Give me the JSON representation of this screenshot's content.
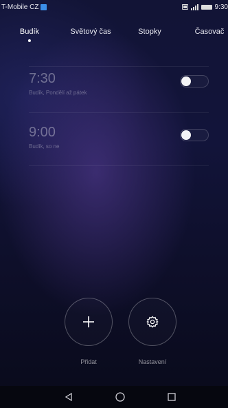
{
  "status_bar": {
    "carrier": "T-Mobile CZ",
    "time": "9:30"
  },
  "tabs": [
    {
      "label": "Budík",
      "active": true
    },
    {
      "label": "Světový čas",
      "active": false
    },
    {
      "label": "Stopky",
      "active": false
    },
    {
      "label": "Časovač",
      "active": false
    }
  ],
  "alarms": [
    {
      "time": "7:30",
      "label": "Budík, Pondělí až pátek",
      "enabled": false
    },
    {
      "time": "9:00",
      "label": "Budík, so ne",
      "enabled": false
    }
  ],
  "actions": {
    "add_label": "Přidat",
    "settings_label": "Nastavení"
  },
  "icons": {
    "add": "plus-icon",
    "settings": "gear-icon",
    "back": "back-triangle-icon",
    "home": "home-circle-icon",
    "recents": "recents-square-icon"
  },
  "colors": {
    "background_top": "#121436",
    "background_glow": "#48348c",
    "toggle_knob": "#f4f4f6",
    "notification_icon": "#3b8ee8"
  }
}
